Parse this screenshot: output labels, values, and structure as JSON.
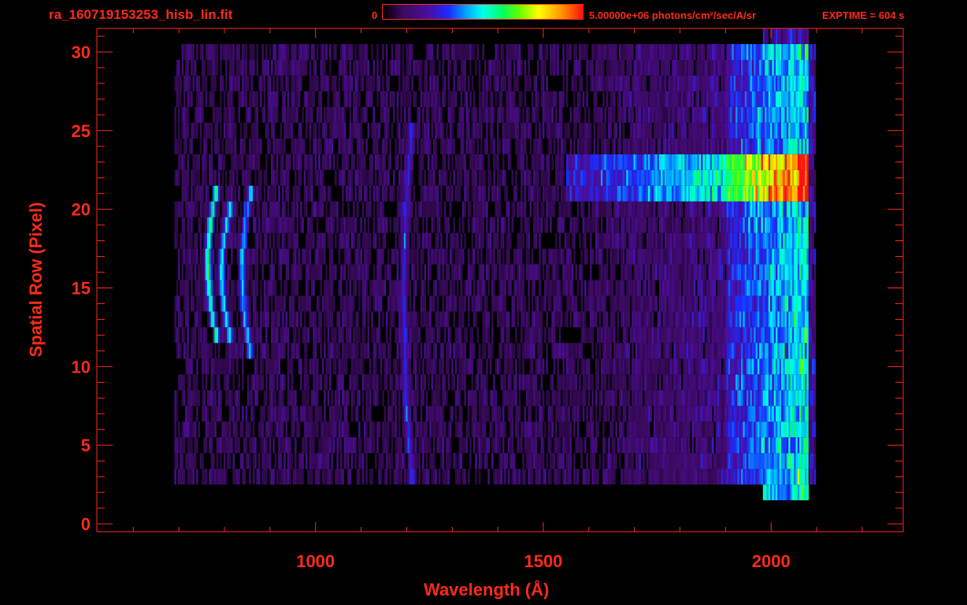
{
  "header": {
    "file_title": "ra_160719153253_hisb_lin.fit",
    "colorbar_min": "0",
    "colorbar_max": "5.00000e+06 photons/cm²/sec/A/sr",
    "exptime": "EXPTIME = 604 s"
  },
  "colors": {
    "axis": "#ff2a1a",
    "background": "#000000"
  },
  "chart_data": {
    "type": "heatmap",
    "xlabel": "Wavelength (Å)",
    "ylabel": "Spatial Row (Pixel)",
    "xlim": [
      520,
      2290
    ],
    "ylim": [
      -0.5,
      31.5
    ],
    "x_ticks": [
      {
        "value": 1000,
        "label": "1000"
      },
      {
        "value": 1500,
        "label": "1500"
      },
      {
        "value": 2000,
        "label": "2000"
      }
    ],
    "y_ticks": [
      {
        "value": 0,
        "label": "0"
      },
      {
        "value": 5,
        "label": "5"
      },
      {
        "value": 10,
        "label": "10"
      },
      {
        "value": 15,
        "label": "15"
      },
      {
        "value": 20,
        "label": "20"
      },
      {
        "value": 25,
        "label": "25"
      },
      {
        "value": 30,
        "label": "30"
      }
    ],
    "colorbar": {
      "min": 0,
      "max": 5000000,
      "units": "photons/cm²/sec/A/sr",
      "colormap": "rainbow"
    },
    "data_extent": {
      "x": [
        690,
        2095
      ],
      "rows": [
        3,
        30
      ]
    },
    "features": [
      {
        "wavelength": 780,
        "rows": [
          12,
          21
        ],
        "relative_intensity": 0.62
      },
      {
        "wavelength": 810,
        "rows": [
          12,
          20
        ],
        "relative_intensity": 0.5
      },
      {
        "wavelength": 855,
        "rows": [
          11,
          21
        ],
        "relative_intensity": 0.42
      },
      {
        "wavelength": 1210,
        "rows": [
          3,
          25
        ],
        "relative_intensity": 0.25
      },
      {
        "wavelength_range": [
          1550,
          2080
        ],
        "rows": [
          21,
          23
        ],
        "relative_intensity": 0.6
      },
      {
        "wavelength_range": [
          1900,
          2080
        ],
        "rows": [
          2,
          30
        ],
        "relative_intensity": 0.4
      }
    ]
  }
}
